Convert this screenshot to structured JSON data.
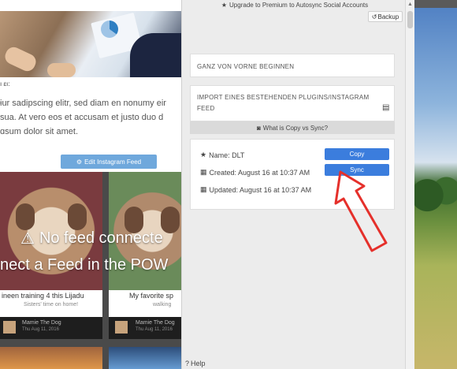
{
  "site": {
    "meta_line": "ı ɛı:",
    "text_line1": "ɨur sadipscing elitr, sed diam en nonumy eir",
    "text_line2": "sua. At vero eos et accusam et justo duo d",
    "text_line3": "ɑsum dolor sit amet.",
    "edit_button": "Edit Instagram Feed",
    "no_feed": "No feed connecte",
    "connect": "nect a Feed in the POW",
    "cards": [
      {
        "title": "ineen training 4 this Lijadu",
        "sub": "Sisters' time on home!",
        "name": "Mamie The Dog",
        "date": "Thu Aug 11, 2016"
      },
      {
        "title": "My favorite sp",
        "sub": "walking",
        "name": "Mamie The Dog",
        "date": "Thu Aug 11, 2016"
      }
    ]
  },
  "panel": {
    "upgrade": "Upgrade to Premium to Autosync Social Accounts",
    "backup": "Backup",
    "start_over": "GANZ VON VORNE BEGINNEN",
    "import_line1": "IMPORT EINES BESTEHENDEN PLUGINS/INSTAGRAM",
    "import_line2": "FEED",
    "copy_sync_bar": "What is Copy vs Sync?",
    "feed_name": "Name: DLT",
    "created": "Created: August 16 at 10:37 AM",
    "updated": "Updated: August 16 at 10:37 AM",
    "copy_button": "Copy",
    "sync_button": "Sync",
    "help": "Help"
  },
  "colors": {
    "button_blue": "#3b7ddd",
    "edit_button_blue": "#6fa8dc",
    "arrow_red": "#e5302b",
    "panel_bg": "#ececec"
  },
  "icons": [
    "star-icon",
    "undo-icon",
    "document-icon",
    "question-icon",
    "calendar-icon",
    "cogs-icon",
    "warning-icon",
    "help-icon"
  ]
}
